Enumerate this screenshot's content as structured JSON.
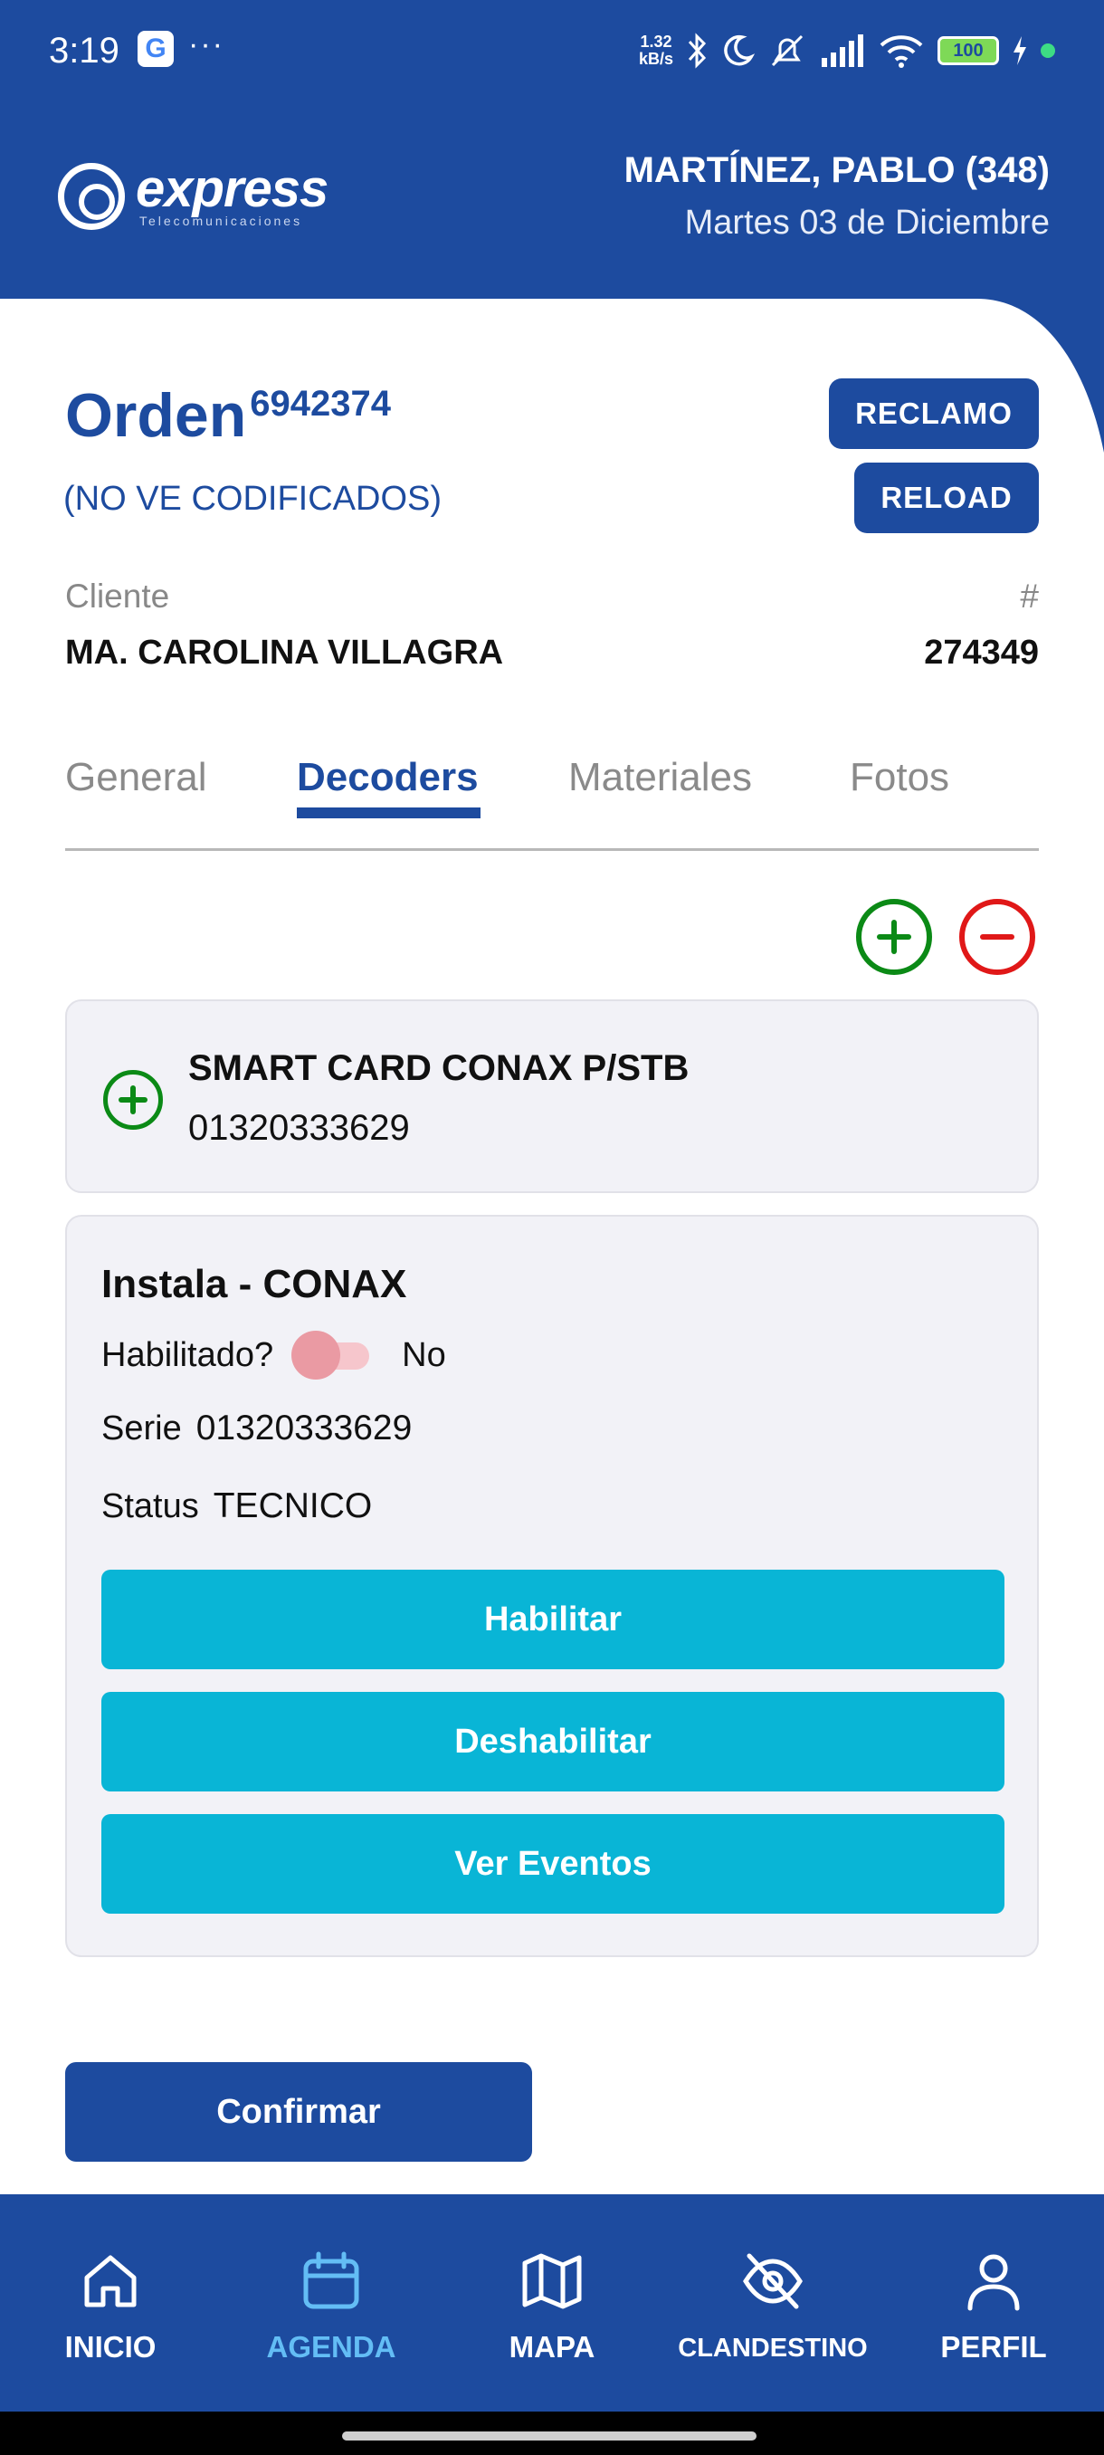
{
  "status_bar": {
    "time": "3:19",
    "notification_icon": "G",
    "more": "···",
    "net_speed_value": "1.32",
    "net_speed_unit": "kB/s",
    "battery": "100"
  },
  "header": {
    "logo_text": "express",
    "logo_subtext": "Telecomunicaciones",
    "user_name": "MARTÍNEZ, PABLO (348)",
    "date": "Martes 03 de Diciembre",
    "brand_color": "#1d4b9f"
  },
  "order": {
    "label": "Orden",
    "number": "6942374",
    "subtitle": "(NO VE CODIFICADOS)",
    "reclamo_label": "RECLAMO",
    "reload_label": "RELOAD"
  },
  "client": {
    "label": "Cliente",
    "hash_label": "#",
    "name": "MA. CAROLINA VILLAGRA",
    "id": "274349"
  },
  "tabs": [
    {
      "label": "General",
      "active": false
    },
    {
      "label": "Decoders",
      "active": true
    },
    {
      "label": "Materiales",
      "active": false
    },
    {
      "label": "Fotos",
      "active": false
    }
  ],
  "actions": {
    "add_icon": "plus-circle-icon",
    "remove_icon": "minus-circle-icon",
    "add_color": "#0b8a16",
    "remove_color": "#e01818"
  },
  "decoder_card": {
    "title": "SMART CARD CONAX P/STB",
    "serial": "01320333629"
  },
  "detail_card": {
    "title": "Instala - CONAX",
    "enabled_label": "Habilitado?",
    "enabled_value": "No",
    "serie_label": "Serie",
    "serie_value": "01320333629",
    "status_label": "Status",
    "status_value": "TECNICO",
    "habilitar_label": "Habilitar",
    "deshabilitar_label": "Deshabilitar",
    "ver_eventos_label": "Ver Eventos",
    "button_color": "#09b5d6"
  },
  "confirm_label": "Confirmar",
  "bottom_nav": [
    {
      "label": "INICIO",
      "icon": "home-icon",
      "active": false
    },
    {
      "label": "AGENDA",
      "icon": "calendar-icon",
      "active": true
    },
    {
      "label": "MAPA",
      "icon": "map-icon",
      "active": false
    },
    {
      "label": "CLANDESTINO",
      "icon": "eye-off-icon",
      "active": false
    },
    {
      "label": "PERFIL",
      "icon": "user-icon",
      "active": false
    }
  ]
}
